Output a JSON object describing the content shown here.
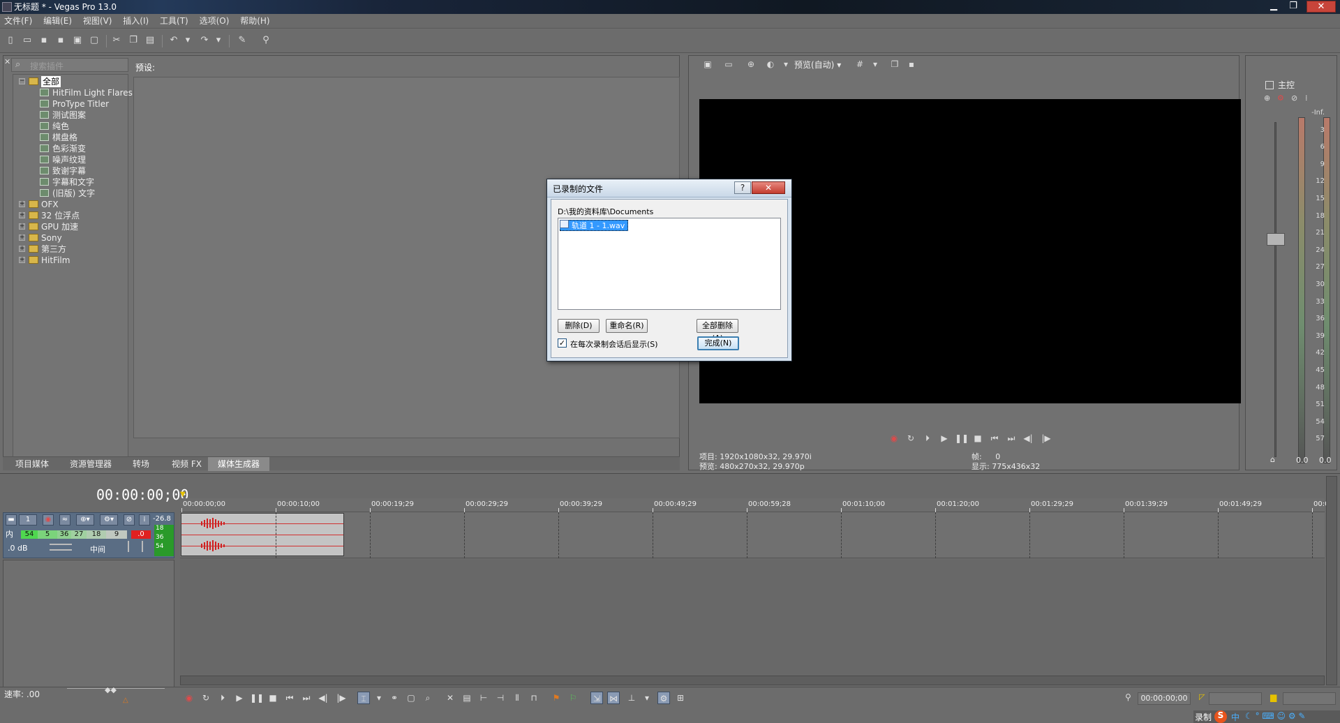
{
  "window": {
    "title": "无标题 * - Vegas Pro 13.0",
    "minimize": "▁",
    "maximize": "❐",
    "close": "✕"
  },
  "menu": [
    "文件(F)",
    "编辑(E)",
    "视图(V)",
    "插入(I)",
    "工具(T)",
    "选项(O)",
    "帮助(H)"
  ],
  "plugins": {
    "search_placeholder": "搜索插件",
    "preset_label": "预设:",
    "tree": [
      {
        "label": "全部",
        "type": "folder",
        "level": 0,
        "toggle": "−",
        "selected": true
      },
      {
        "label": "HitFilm Light Flares",
        "type": "plugin",
        "level": 1
      },
      {
        "label": "ProType Titler",
        "type": "plugin",
        "level": 1
      },
      {
        "label": "测试图案",
        "type": "plugin",
        "level": 1
      },
      {
        "label": "纯色",
        "type": "plugin",
        "level": 1
      },
      {
        "label": "棋盘格",
        "type": "plugin",
        "level": 1
      },
      {
        "label": "色彩渐变",
        "type": "plugin",
        "level": 1
      },
      {
        "label": "噪声纹理",
        "type": "plugin",
        "level": 1
      },
      {
        "label": "致谢字幕",
        "type": "plugin",
        "level": 1
      },
      {
        "label": "字幕和文字",
        "type": "plugin",
        "level": 1
      },
      {
        "label": "(旧版) 文字",
        "type": "plugin",
        "level": 1
      },
      {
        "label": "OFX",
        "type": "folder",
        "level": 0,
        "toggle": "+"
      },
      {
        "label": "32 位浮点",
        "type": "folder",
        "level": 0,
        "toggle": "+"
      },
      {
        "label": "GPU 加速",
        "type": "folder",
        "level": 0,
        "toggle": "+"
      },
      {
        "label": "Sony",
        "type": "folder",
        "level": 0,
        "toggle": "+"
      },
      {
        "label": "第三方",
        "type": "folder",
        "level": 0,
        "toggle": "+"
      },
      {
        "label": "HitFilm",
        "type": "folder",
        "level": 0,
        "toggle": "+"
      }
    ]
  },
  "left_tabs": [
    {
      "label": "项目媒体",
      "active": false
    },
    {
      "label": "资源管理器",
      "active": false
    },
    {
      "label": "转场",
      "active": false
    },
    {
      "label": "视频 FX",
      "active": false
    },
    {
      "label": "媒体生成器",
      "active": true
    }
  ],
  "preview": {
    "quality": "预览(自动)",
    "project_label": "项目:",
    "project_value": "1920x1080x32, 29.970i",
    "preview_label": "预览:",
    "preview_value": "480x270x32, 29.970p",
    "frame_label": "帧:",
    "frame_value": "0",
    "display_label": "显示:",
    "display_value": "775x436x32"
  },
  "master": {
    "label": "主控",
    "scale": [
      "-Inf.",
      "3",
      "6",
      "9",
      "12",
      "15",
      "18",
      "21",
      "24",
      "27",
      "30",
      "33",
      "36",
      "39",
      "42",
      "45",
      "48",
      "51",
      "54",
      "57"
    ],
    "bottom_left": "0.0",
    "bottom_right": "0.0"
  },
  "timeline": {
    "time": "00:00:00;00",
    "ruler": [
      "00:00:00;00",
      "00:00:10;00",
      "00:00:19;29",
      "00:00:29;29",
      "00:00:39;29",
      "00:00:49;29",
      "00:00:59;28",
      "00:01:10;00",
      "00:01:20;00",
      "00:01:29;29",
      "00:01:39;29",
      "00:01:49;29",
      "00:0"
    ],
    "track": {
      "number": "1",
      "peak": "-26.8",
      "input_label": "内",
      "meter": [
        "54",
        "5",
        "36",
        "27",
        "18",
        "9",
        ".0"
      ],
      "volume": ".0 dB",
      "pan": "中间",
      "side_meter": [
        "18",
        "36",
        "54"
      ]
    },
    "rate_label": "速率:",
    "rate_value": ".00",
    "bottom_time": "00:00:00;00"
  },
  "dialog": {
    "title": "已录制的文件",
    "help": "?",
    "close": "✕",
    "path": "D:\\我的资料库\\Documents",
    "files": [
      "轨道 1 - 1.wav"
    ],
    "delete_button": "删除(D)",
    "rename_button": "重命名(R)",
    "delete_all_button": "全部删除(A)",
    "show_after_checkbox": "在每次录制会话后显示(S)",
    "show_after_checked": true,
    "done_button": "完成(N)"
  },
  "ime": {
    "text": "录制",
    "mode": "中"
  }
}
